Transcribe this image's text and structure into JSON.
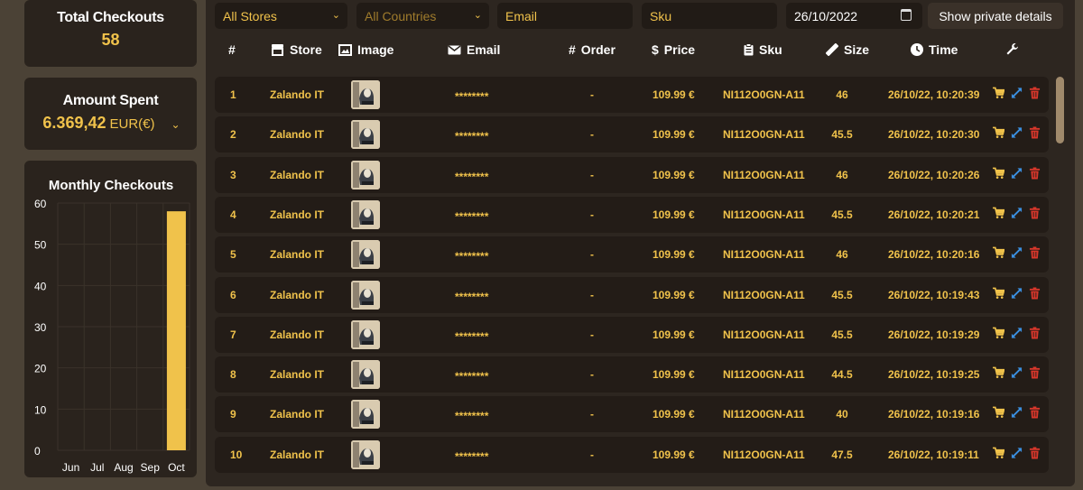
{
  "stats": {
    "total_checkouts_label": "Total Checkouts",
    "total_checkouts_value": "58",
    "amount_spent_label": "Amount Spent",
    "amount_spent_value": "6.369,42",
    "amount_spent_unit": "EUR(€)",
    "monthly_label": "Monthly Checkouts"
  },
  "chart_data": {
    "type": "bar",
    "title": "Monthly Checkouts",
    "categories": [
      "Jun",
      "Jul",
      "Aug",
      "Sep",
      "Oct"
    ],
    "values": [
      0,
      0,
      0,
      0,
      58
    ],
    "ylim": [
      0,
      60
    ],
    "yticks": [
      "0",
      "10",
      "20",
      "30",
      "40",
      "50",
      "60"
    ],
    "grid": true,
    "bar_color": "#f0c24b"
  },
  "filters": {
    "stores": "All Stores",
    "countries": "All Countries",
    "email_placeholder": "Email",
    "sku_placeholder": "Sku",
    "date": "26/10/2022",
    "private_button": "Show private details"
  },
  "columns": {
    "num": "#",
    "store": "Store",
    "image": "Image",
    "email": "Email",
    "order": "Order",
    "price": "Price",
    "sku": "Sku",
    "size": "Size",
    "time": "Time"
  },
  "colors": {
    "accent": "#f0c24b",
    "expand": "#3b8fe0",
    "delete": "#d9372b"
  },
  "rows": [
    {
      "num": "1",
      "store": "Zalando IT",
      "email": "********",
      "order": "-",
      "price": "109.99 €",
      "sku": "NI112O0GN-A11",
      "size": "46",
      "time": "26/10/22, 10:20:39"
    },
    {
      "num": "2",
      "store": "Zalando IT",
      "email": "********",
      "order": "-",
      "price": "109.99 €",
      "sku": "NI112O0GN-A11",
      "size": "45.5",
      "time": "26/10/22, 10:20:30"
    },
    {
      "num": "3",
      "store": "Zalando IT",
      "email": "********",
      "order": "-",
      "price": "109.99 €",
      "sku": "NI112O0GN-A11",
      "size": "46",
      "time": "26/10/22, 10:20:26"
    },
    {
      "num": "4",
      "store": "Zalando IT",
      "email": "********",
      "order": "-",
      "price": "109.99 €",
      "sku": "NI112O0GN-A11",
      "size": "45.5",
      "time": "26/10/22, 10:20:21"
    },
    {
      "num": "5",
      "store": "Zalando IT",
      "email": "********",
      "order": "-",
      "price": "109.99 €",
      "sku": "NI112O0GN-A11",
      "size": "46",
      "time": "26/10/22, 10:20:16"
    },
    {
      "num": "6",
      "store": "Zalando IT",
      "email": "********",
      "order": "-",
      "price": "109.99 €",
      "sku": "NI112O0GN-A11",
      "size": "45.5",
      "time": "26/10/22, 10:19:43"
    },
    {
      "num": "7",
      "store": "Zalando IT",
      "email": "********",
      "order": "-",
      "price": "109.99 €",
      "sku": "NI112O0GN-A11",
      "size": "45.5",
      "time": "26/10/22, 10:19:29"
    },
    {
      "num": "8",
      "store": "Zalando IT",
      "email": "********",
      "order": "-",
      "price": "109.99 €",
      "sku": "NI112O0GN-A11",
      "size": "44.5",
      "time": "26/10/22, 10:19:25"
    },
    {
      "num": "9",
      "store": "Zalando IT",
      "email": "********",
      "order": "-",
      "price": "109.99 €",
      "sku": "NI112O0GN-A11",
      "size": "40",
      "time": "26/10/22, 10:19:16"
    },
    {
      "num": "10",
      "store": "Zalando IT",
      "email": "********",
      "order": "-",
      "price": "109.99 €",
      "sku": "NI112O0GN-A11",
      "size": "47.5",
      "time": "26/10/22, 10:19:11"
    }
  ]
}
